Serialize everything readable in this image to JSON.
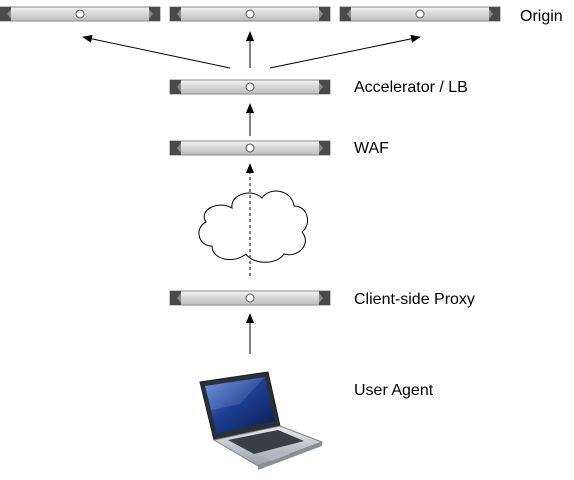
{
  "diagram": {
    "labels": {
      "origin": "Origin",
      "accelerator": "Accelerator / LB",
      "waf": "WAF",
      "proxy": "Client-side Proxy",
      "user_agent": "User Agent"
    }
  },
  "icons": {
    "server": "server-rack-icon",
    "cloud": "cloud-icon",
    "laptop": "laptop-icon"
  },
  "colors": {
    "server_body": "#dcdcdc",
    "server_cap": "#4a4a4a",
    "arrow": "#000000",
    "laptop_body": "#c8ccd1",
    "laptop_screen": "#1f3d8a",
    "cloud_stroke": "#000000"
  }
}
